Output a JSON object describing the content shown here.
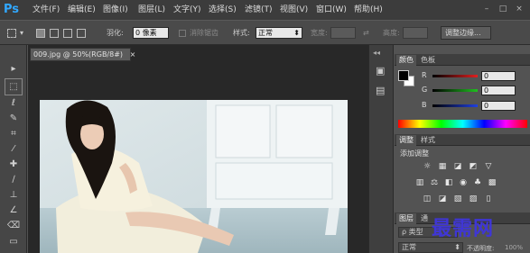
{
  "app": {
    "logo": "Ps"
  },
  "menu": [
    "文件(F)",
    "编辑(E)",
    "图像(I)",
    "图层(L)",
    "文字(Y)",
    "选择(S)",
    "滤镜(T)",
    "视图(V)",
    "窗口(W)",
    "帮助(H)"
  ],
  "window_controls": {
    "minimize": "–",
    "restore": "□",
    "close": "×"
  },
  "options": {
    "feather_label": "羽化:",
    "feather_value": "0 像素",
    "antialias_label": "消除锯齿",
    "style_label": "样式:",
    "style_value": "正常",
    "width_label": "宽度:",
    "height_label": "高度:",
    "refine_button": "调整边缘..."
  },
  "document": {
    "tab_title": "009.jpg @ 50%(RGB/8#)",
    "close": "×"
  },
  "color_panel": {
    "tabs": [
      "颜色",
      "色板"
    ],
    "channels": [
      {
        "label": "R",
        "value": "0",
        "color": "#e02020"
      },
      {
        "label": "G",
        "value": "0",
        "color": "#20c020"
      },
      {
        "label": "B",
        "value": "0",
        "color": "#2040e0"
      }
    ]
  },
  "adjust_panel": {
    "tabs": [
      "调整",
      "样式"
    ],
    "title": "添加调整"
  },
  "layers_panel": {
    "tabs": [
      "图层",
      "通"
    ],
    "kind_label": "ρ 类型",
    "blend_value": "正常",
    "opacity_label": "不透明度:",
    "opacity_value": "100%"
  },
  "watermark": "最需网",
  "colors": {
    "menubar": "#3c3c3c",
    "panel": "#535353",
    "logo": "#31a8ff",
    "workspace": "#282828"
  }
}
